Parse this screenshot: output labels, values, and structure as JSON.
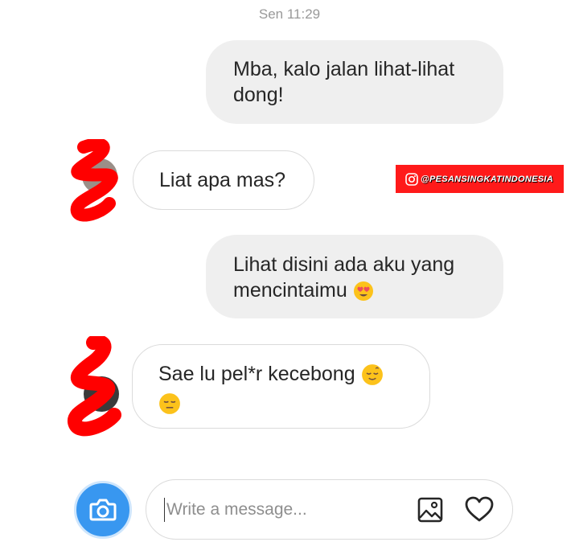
{
  "timestamp": "Sen 11:29",
  "messages": [
    {
      "line1": "Mba, kalo jalan lihat-lihat",
      "line2": "dong!"
    },
    {
      "line1": "Liat apa mas?"
    },
    {
      "line1": "Lihat disini ada aku yang",
      "line2": "mencintaimu"
    },
    {
      "line1": "Sae lu pel*r kecebong"
    }
  ],
  "watermark": {
    "handle": "@PESANSINGKATINDONESIA",
    "color": "#ff1a1a"
  },
  "composer": {
    "placeholder": "Write a message..."
  },
  "colors": {
    "sent_bubble": "#efefef",
    "received_border": "#dbdbdb",
    "camera_button": "#3897f0",
    "redaction": "#ff0000"
  },
  "icons": [
    "camera-icon",
    "gallery-icon",
    "heart-icon",
    "heart-eyes-emoji",
    "relieved-emoji",
    "expressionless-emoji",
    "instagram-icon"
  ]
}
